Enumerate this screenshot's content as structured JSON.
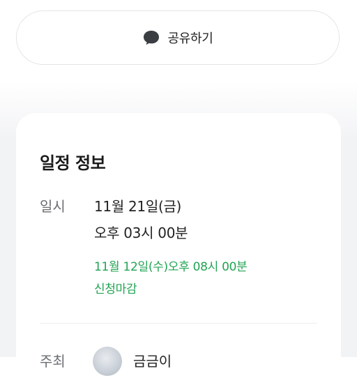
{
  "share": {
    "label": "공유하기",
    "icon": "chat-bubble-icon"
  },
  "schedule": {
    "title": "일정 정보",
    "datetime_label": "일시",
    "date_line": "11월 21일(금)",
    "time_line": "오후 03시 00분",
    "deadline_line": "11월 12일(수)오후 08시 00분",
    "deadline_note": "신청마감",
    "host_label": "주최",
    "host_name": "금금이"
  },
  "colors": {
    "accent_green": "#21a453",
    "card_bg": "#ffffff",
    "page_bg": "#f2f3f5"
  }
}
